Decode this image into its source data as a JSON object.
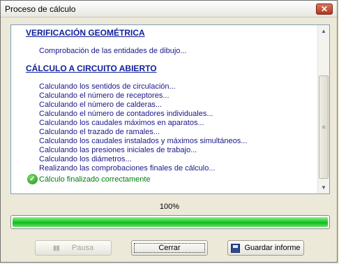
{
  "window": {
    "title": "Proceso de cálculo",
    "close_glyph": "✕"
  },
  "log": {
    "section1_title": "VERIFICACIÓN GEOMÉTRICA",
    "section1_lines": [
      "Comprobación de las entidades de dibujo..."
    ],
    "section2_title": "CÁLCULO A CIRCUITO ABIERTO",
    "section2_lines": [
      "Calculando los sentidos de circulación...",
      "Calculando el número de receptores...",
      "Calculando el número de calderas...",
      "Calculando el número de contadores individuales...",
      "Calculando los caudales máximos en aparatos...",
      "Calculando el trazado de ramales...",
      "Calculando los caudales instalados y máximos simultáneos...",
      "Calculando las presiones iniciales de trabajo...",
      "Calculando los diámetros...",
      "Realizando las comprobaciones finales de cálculo..."
    ],
    "success_message": "Cálculo finalizado correctamente",
    "success_icon": "check-circle-icon",
    "success_color": "#00800d"
  },
  "progress": {
    "percent_label": "100%",
    "value": 1.0,
    "fill_color": "#1fce2b"
  },
  "buttons": {
    "pause_label": "Pausa",
    "close_label": "Cerrar",
    "save_label": "Guardar informe"
  }
}
